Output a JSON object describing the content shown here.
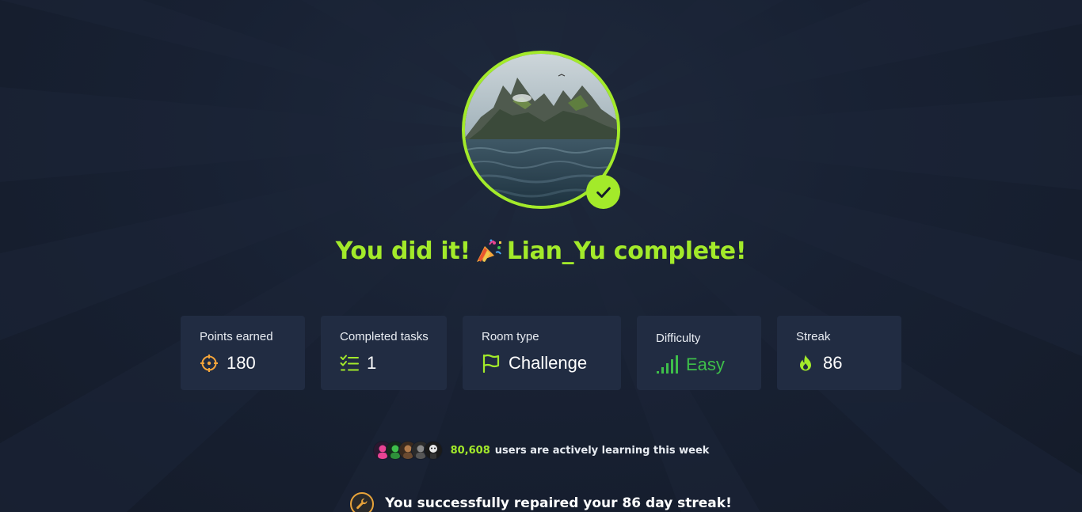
{
  "completion": {
    "prefix": "You did it!",
    "suffix": "Lian_Yu complete!",
    "accent_color": "#a3ea2a"
  },
  "avatar": {
    "image_alt": "island in the ocean",
    "badge_icon": "check-icon"
  },
  "stats": [
    {
      "label": "Points earned",
      "value": "180",
      "icon": "crosshair-icon",
      "icon_color": "#f5a53a"
    },
    {
      "label": "Completed tasks",
      "value": "1",
      "icon": "checklist-icon",
      "icon_color": "#a3ea2a"
    },
    {
      "label": "Room type",
      "value": "Challenge",
      "icon": "flag-icon",
      "icon_color": "#a3ea2a"
    },
    {
      "label": "Difficulty",
      "value": "Easy",
      "icon": "signal-bars-icon",
      "icon_color": "#3ebf4a"
    },
    {
      "label": "Streak",
      "value": "86",
      "icon": "fire-icon",
      "icon_color": "#a3ea2a"
    }
  ],
  "learners": {
    "count": "80,608",
    "text": "users are actively learning this week"
  },
  "streak_repair": {
    "text": "You successfully repaired your 86 day streak!",
    "icon": "wrench-icon"
  }
}
